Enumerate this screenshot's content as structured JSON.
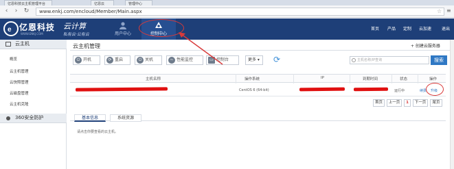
{
  "browser": {
    "tabs": [
      "亿恩科技云主机管理平台",
      "亿恩云",
      "管理中心"
    ],
    "url": "www.enkj.com/encloud/Member/Main.aspx"
  },
  "header": {
    "brand": "亿恩科技",
    "domain": "WWW.ENKJ.COM",
    "slogan_main": "云计算",
    "slogan_sub": "私有云·公有云",
    "nav": [
      {
        "label": "用户中心",
        "icon": "user-icon"
      },
      {
        "label": "控制中心",
        "icon": "cloud-control-icon"
      }
    ],
    "right_links": [
      "首页",
      "产品",
      "定制",
      "云加速",
      "退出"
    ]
  },
  "sidebar": {
    "sections": [
      {
        "title": "云主机",
        "icon": "server-icon",
        "items": [
          "概览",
          "云主机管理",
          "云快照管理",
          "云磁盘管理",
          "云主机克隆"
        ]
      },
      {
        "title": "360安全防护",
        "icon": "shield-icon",
        "items": []
      }
    ]
  },
  "main": {
    "title": "云主机管理",
    "create_link": "+ 创建云服务器",
    "toolbar": [
      {
        "label": "开机",
        "icon": "power-icon"
      },
      {
        "label": "重启",
        "icon": "restart-icon"
      },
      {
        "label": "关机",
        "icon": "power-off-icon"
      },
      {
        "label": "性能监控",
        "icon": "monitor-icon"
      },
      {
        "label": "控制台",
        "icon": "console-icon"
      }
    ],
    "more_label": "更多 ▾",
    "search": {
      "placeholder": "主机名称/IP查询",
      "button": "搜索"
    },
    "table": {
      "headers": [
        "主机名称",
        "操作系统",
        "IP",
        "到期时间",
        "状态",
        "操作"
      ],
      "rows": [
        {
          "name": "",
          "os": "CentOS 6 (64-bit)",
          "ip": "",
          "expire": "",
          "status": "运行中",
          "actions": [
            "续费",
            "升级"
          ]
        }
      ]
    },
    "pager": {
      "first": "首页",
      "prev": "上一页",
      "current": "1",
      "next": "下一页",
      "last": "尾页"
    },
    "info_tabs": [
      "基本信息",
      "系统资源"
    ],
    "info_text": "请点击你要查看的云主机。"
  },
  "colors": {
    "header_bg": "#1e3f78",
    "accent": "#2f78c4",
    "highlight": "#d93a3a"
  }
}
